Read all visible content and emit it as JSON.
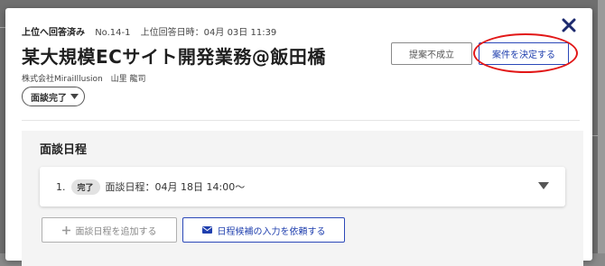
{
  "header": {
    "status": "上位へ回答済み",
    "number": "No.14-1",
    "answered_time": "上位回答日時：04月 03日 11:39"
  },
  "title": "某大規模ECサイト開発業務@飯田橋",
  "company": {
    "name": "株式会社MiraiIllusion",
    "person": "山里 龍司"
  },
  "status_select": {
    "value": "面談完了"
  },
  "actions": {
    "reject_label": "提案不成立",
    "decide_label": "案件を決定する"
  },
  "interview": {
    "section_title": "面談日程",
    "items": [
      {
        "index": "1.",
        "badge": "完了",
        "label": "面談日程：04月 18日 14:00〜"
      }
    ],
    "add_label": "面談日程を追加する",
    "request_label": "日程候補の入力を依頼する"
  },
  "colors": {
    "accent": "#1f3fae",
    "highlight": "#e21818"
  }
}
